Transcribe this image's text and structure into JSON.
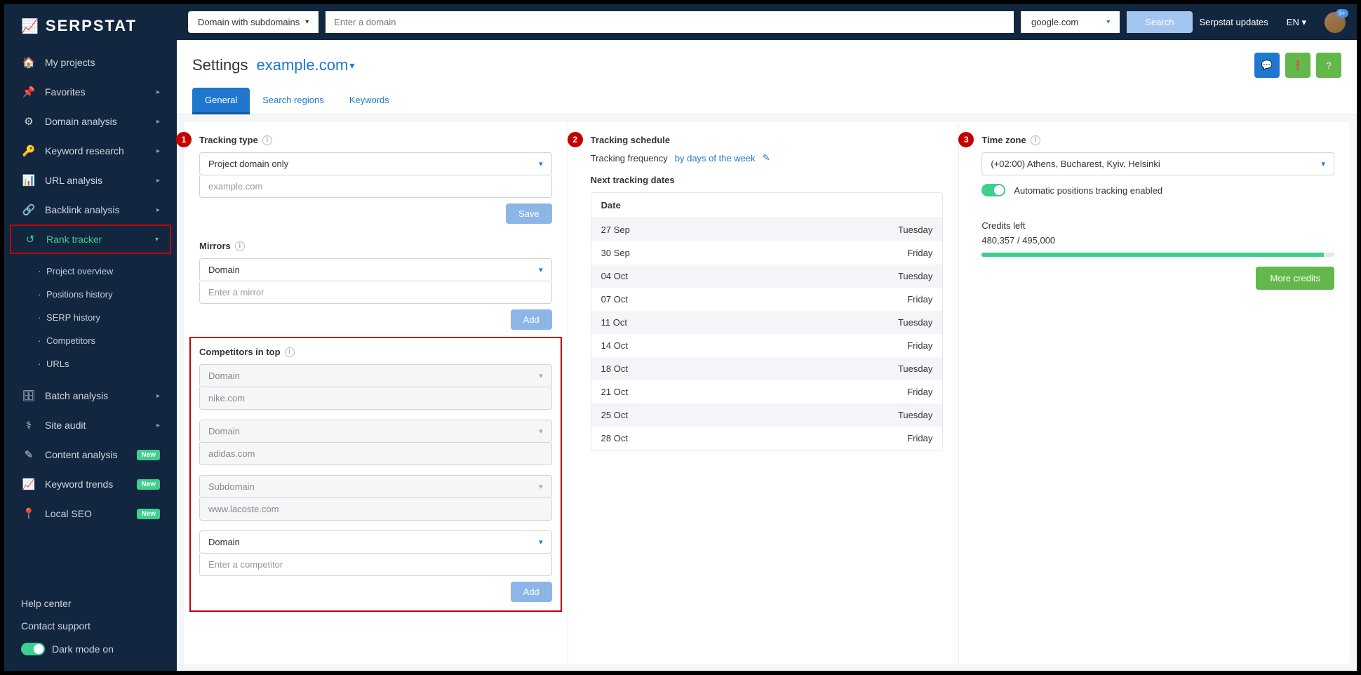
{
  "brand": "SERPSTAT",
  "topbar": {
    "domain_type": "Domain with subdomains",
    "search_placeholder": "Enter a domain",
    "engine": "google.com",
    "search_btn": "Search",
    "updates": "Serpstat updates",
    "lang": "EN",
    "notif": "9+"
  },
  "nav": {
    "items": [
      {
        "icon": "🏠",
        "label": "My projects",
        "chev": false
      },
      {
        "icon": "📌",
        "label": "Favorites",
        "chev": true
      },
      {
        "icon": "⚙",
        "label": "Domain analysis",
        "chev": true
      },
      {
        "icon": "🔑",
        "label": "Keyword research",
        "chev": true
      },
      {
        "icon": "📊",
        "label": "URL analysis",
        "chev": true
      },
      {
        "icon": "🔗",
        "label": "Backlink analysis",
        "chev": true
      }
    ],
    "active": {
      "icon": "↺",
      "label": "Rank tracker"
    },
    "subs": [
      "Project overview",
      "Positions history",
      "SERP history",
      "Competitors",
      "URLs"
    ],
    "items2": [
      {
        "icon": "🗄",
        "label": "Batch analysis",
        "chev": true,
        "badge": ""
      },
      {
        "icon": "⚕",
        "label": "Site audit",
        "chev": true,
        "badge": ""
      },
      {
        "icon": "✎",
        "label": "Content analysis",
        "chev": false,
        "badge": "New"
      },
      {
        "icon": "📈",
        "label": "Keyword trends",
        "chev": false,
        "badge": "New"
      },
      {
        "icon": "📍",
        "label": "Local SEO",
        "chev": false,
        "badge": "New"
      }
    ]
  },
  "footer": {
    "help": "Help center",
    "contact": "Contact support",
    "dark": "Dark mode on"
  },
  "page": {
    "title": "Settings",
    "domain": "example.com",
    "tabs": [
      "General",
      "Search regions",
      "Keywords"
    ]
  },
  "col1": {
    "badge": "1",
    "tracking_type": {
      "title": "Tracking type",
      "value": "Project domain only",
      "input": "example.com",
      "btn": "Save"
    },
    "mirrors": {
      "title": "Mirrors",
      "value": "Domain",
      "placeholder": "Enter a mirror",
      "btn": "Add"
    },
    "competitors": {
      "title": "Competitors in top",
      "rows": [
        {
          "type": "Domain",
          "val": "nike.com"
        },
        {
          "type": "Domain",
          "val": "adidas.com"
        },
        {
          "type": "Subdomain",
          "val": "www.lacoste.com"
        }
      ],
      "new_type": "Domain",
      "new_placeholder": "Enter a competitor",
      "btn": "Add"
    }
  },
  "col2": {
    "badge": "2",
    "title": "Tracking schedule",
    "freq_label": "Tracking frequency",
    "freq_value": "by days of the week",
    "next_label": "Next tracking dates",
    "date_head": "Date",
    "dates": [
      {
        "d": "27 Sep",
        "w": "Tuesday"
      },
      {
        "d": "30 Sep",
        "w": "Friday"
      },
      {
        "d": "04 Oct",
        "w": "Tuesday"
      },
      {
        "d": "07 Oct",
        "w": "Friday"
      },
      {
        "d": "11 Oct",
        "w": "Tuesday"
      },
      {
        "d": "14 Oct",
        "w": "Friday"
      },
      {
        "d": "18 Oct",
        "w": "Tuesday"
      },
      {
        "d": "21 Oct",
        "w": "Friday"
      },
      {
        "d": "25 Oct",
        "w": "Tuesday"
      },
      {
        "d": "28 Oct",
        "w": "Friday"
      }
    ]
  },
  "col3": {
    "badge": "3",
    "title": "Time zone",
    "tz_value": "(+02:00) Athens, Bucharest, Kyiv, Helsinki",
    "toggle_label": "Automatic positions tracking enabled",
    "credits_title": "Credits left",
    "credits_value": "480,357 / 495,000",
    "credits_pct": 97,
    "more_btn": "More credits"
  }
}
